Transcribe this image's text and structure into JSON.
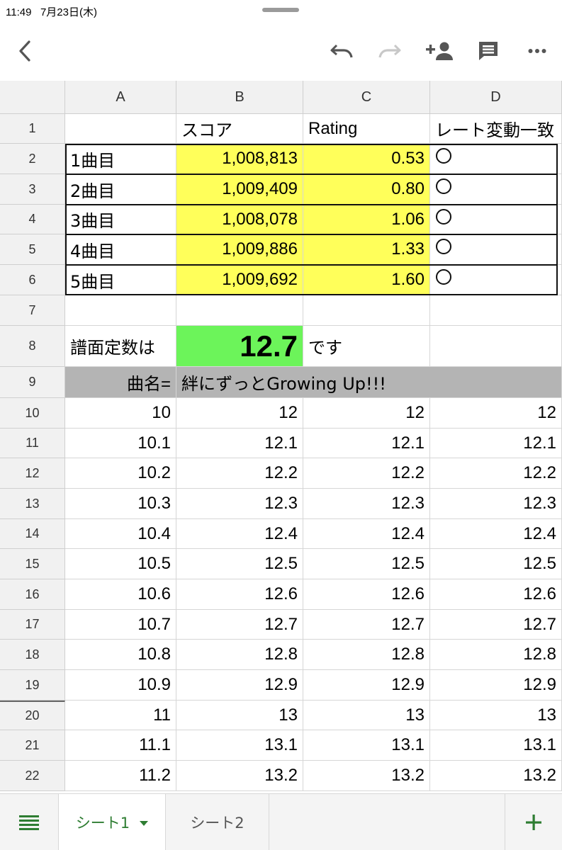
{
  "status": {
    "time": "11:49",
    "date": "7月23日(木)"
  },
  "toolbar": {
    "back_icon": "chevron-left-icon",
    "undo_icon": "undo-icon",
    "redo_icon": "redo-icon",
    "share_icon": "add-person-icon",
    "comment_icon": "comment-icon",
    "more_icon": "more-horizontal-icon"
  },
  "columns": [
    "A",
    "B",
    "C",
    "D"
  ],
  "rows": {
    "r1": {
      "num": "1",
      "a": "",
      "b": "スコア",
      "c": "Rating",
      "d": "レート変動一致"
    },
    "r2": {
      "num": "2",
      "a": "1曲目",
      "b": "1,008,813",
      "c": "0.53",
      "d": "◯"
    },
    "r3": {
      "num": "3",
      "a": "2曲目",
      "b": "1,009,409",
      "c": "0.80",
      "d": "◯"
    },
    "r4": {
      "num": "4",
      "a": "3曲目",
      "b": "1,008,078",
      "c": "1.06",
      "d": "◯"
    },
    "r5": {
      "num": "5",
      "a": "4曲目",
      "b": "1,009,886",
      "c": "1.33",
      "d": "◯"
    },
    "r6": {
      "num": "6",
      "a": "5曲目",
      "b": "1,009,692",
      "c": "1.60",
      "d": "◯"
    },
    "r7": {
      "num": "7",
      "a": "",
      "b": "",
      "c": "",
      "d": ""
    },
    "r8": {
      "num": "8",
      "a": "譜面定数は",
      "b": "12.7",
      "c": "です",
      "d": ""
    },
    "r9": {
      "num": "9",
      "a": "曲名=",
      "b": "絆にずっとGrowing Up!!!"
    },
    "r10": {
      "num": "10",
      "a": "10",
      "b": "12",
      "c": "12",
      "d": "12"
    },
    "r11": {
      "num": "11",
      "a": "10.1",
      "b": "12.1",
      "c": "12.1",
      "d": "12.1"
    },
    "r12": {
      "num": "12",
      "a": "10.2",
      "b": "12.2",
      "c": "12.2",
      "d": "12.2"
    },
    "r13": {
      "num": "13",
      "a": "10.3",
      "b": "12.3",
      "c": "12.3",
      "d": "12.3"
    },
    "r14": {
      "num": "14",
      "a": "10.4",
      "b": "12.4",
      "c": "12.4",
      "d": "12.4"
    },
    "r15": {
      "num": "15",
      "a": "10.5",
      "b": "12.5",
      "c": "12.5",
      "d": "12.5"
    },
    "r16": {
      "num": "16",
      "a": "10.6",
      "b": "12.6",
      "c": "12.6",
      "d": "12.6"
    },
    "r17": {
      "num": "17",
      "a": "10.7",
      "b": "12.7",
      "c": "12.7",
      "d": "12.7"
    },
    "r18": {
      "num": "18",
      "a": "10.8",
      "b": "12.8",
      "c": "12.8",
      "d": "12.8"
    },
    "r19": {
      "num": "19",
      "a": "10.9",
      "b": "12.9",
      "c": "12.9",
      "d": "12.9"
    },
    "r20": {
      "num": "20",
      "a": "11",
      "b": "13",
      "c": "13",
      "d": "13"
    },
    "r21": {
      "num": "21",
      "a": "11.1",
      "b": "13.1",
      "c": "13.1",
      "d": "13.1"
    },
    "r22": {
      "num": "22",
      "a": "11.2",
      "b": "13.2",
      "c": "13.2",
      "d": "13.2"
    }
  },
  "tabs": {
    "menu_icon": "hamburger-menu-icon",
    "sheet1": "シート1",
    "sheet2": "シート2",
    "add_icon": "plus-icon"
  },
  "colors": {
    "highlight_yellow": "#ffff5a",
    "highlight_green": "#6cf45a",
    "header_gray": "#b4b4b4",
    "accent_green": "#2e7d32"
  }
}
